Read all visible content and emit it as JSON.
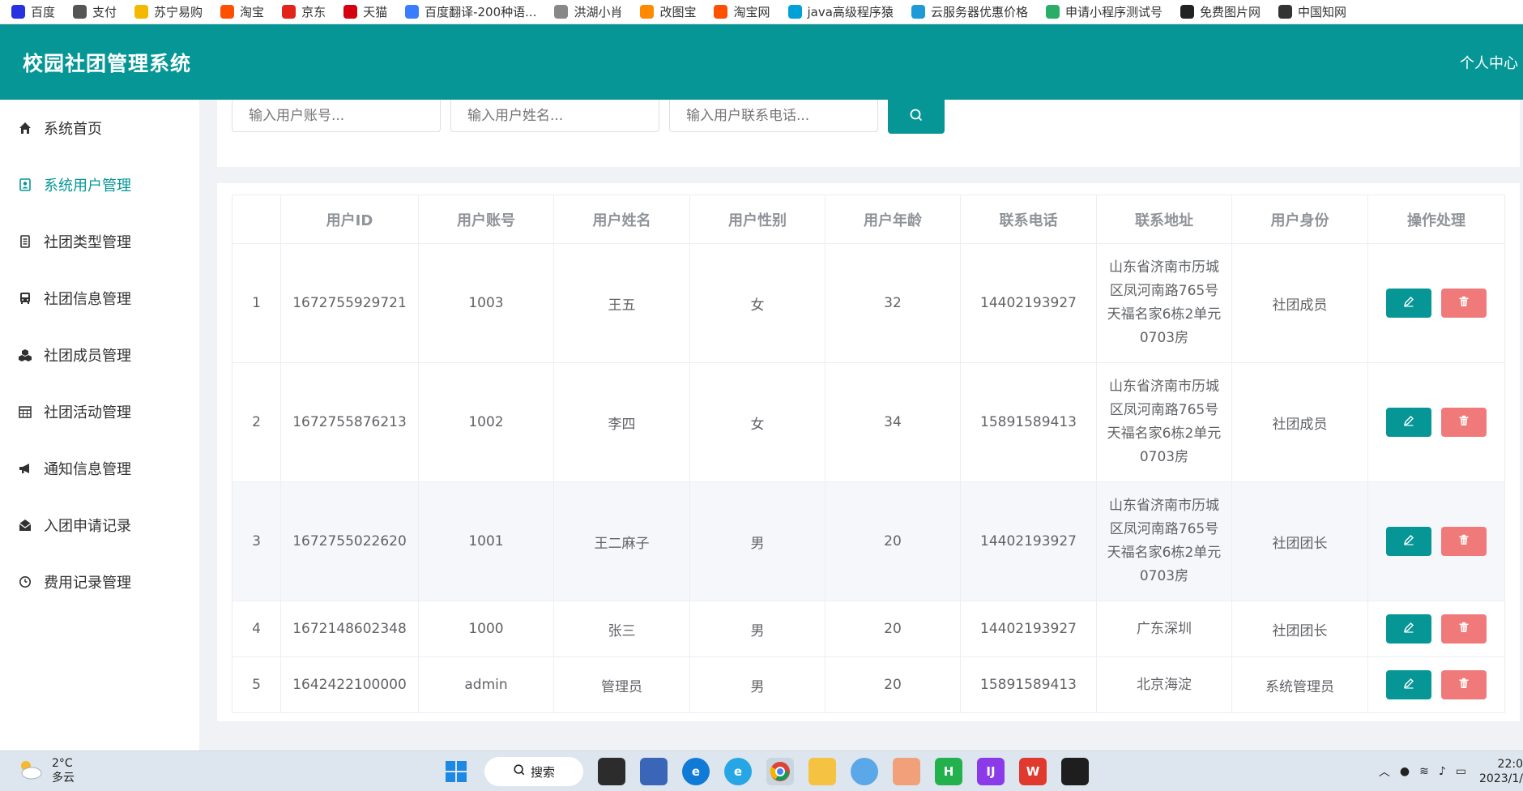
{
  "bookmarks": [
    {
      "label": "百度",
      "icon": "baidu-icon",
      "color": "#2932e1"
    },
    {
      "label": "支付",
      "icon": "globe-icon",
      "color": "#555555"
    },
    {
      "label": "苏宁易购",
      "icon": "suning-icon",
      "color": "#f5b800"
    },
    {
      "label": "淘宝",
      "icon": "taobao-icon",
      "color": "#ff5000"
    },
    {
      "label": "京东",
      "icon": "jd-icon",
      "color": "#e1251b"
    },
    {
      "label": "天猫",
      "icon": "tmall-icon",
      "color": "#d4000f"
    },
    {
      "label": "百度翻译-200种语...",
      "icon": "translate-icon",
      "color": "#3b7cff"
    },
    {
      "label": "洪湖小肖",
      "icon": "rocket-icon",
      "color": "#888888"
    },
    {
      "label": "改图宝",
      "icon": "image-edit-icon",
      "color": "#ff8a00"
    },
    {
      "label": "淘宝网",
      "icon": "taobao-icon",
      "color": "#ff5000"
    },
    {
      "label": "java高级程序猿",
      "icon": "tv-icon",
      "color": "#00a1d6"
    },
    {
      "label": "云服务器优惠价格",
      "icon": "cloud-icon",
      "color": "#1e9bd7"
    },
    {
      "label": "申请小程序测试号",
      "icon": "wechat-icon",
      "color": "#2aae67"
    },
    {
      "label": "免费图片网",
      "icon": "t-icon",
      "color": "#222222"
    },
    {
      "label": "中国知网",
      "icon": "cnki-icon",
      "color": "#333333"
    }
  ],
  "header": {
    "title": "校园社团管理系统",
    "user_center": "个人中心"
  },
  "sidebar": {
    "items": [
      {
        "label": "系统首页",
        "icon": "home-icon",
        "active": false
      },
      {
        "label": "系统用户管理",
        "icon": "user-card-icon",
        "active": true
      },
      {
        "label": "社团类型管理",
        "icon": "list-icon",
        "active": false
      },
      {
        "label": "社团信息管理",
        "icon": "bus-icon",
        "active": false
      },
      {
        "label": "社团成员管理",
        "icon": "cubes-icon",
        "active": false
      },
      {
        "label": "社团活动管理",
        "icon": "calendar-icon",
        "active": false
      },
      {
        "label": "通知信息管理",
        "icon": "bullhorn-icon",
        "active": false
      },
      {
        "label": "入团申请记录",
        "icon": "envelope-icon",
        "active": false
      },
      {
        "label": "费用记录管理",
        "icon": "clock-icon",
        "active": false
      }
    ]
  },
  "search": {
    "account_placeholder": "输入用户账号...",
    "name_placeholder": "输入用户姓名...",
    "phone_placeholder": "输入用户联系电话..."
  },
  "table": {
    "columns": [
      "",
      "用户ID",
      "用户账号",
      "用户姓名",
      "用户性别",
      "用户年龄",
      "联系电话",
      "联系地址",
      "用户身份",
      "操作处理"
    ],
    "rows": [
      {
        "index": "1",
        "id": "1672755929721",
        "account": "1003",
        "name": "王五",
        "gender": "女",
        "age": "32",
        "phone": "14402193927",
        "address": "山东省济南市历城区凤河南路765号天福名家6栋2单元0703房",
        "role": "社团成员"
      },
      {
        "index": "2",
        "id": "1672755876213",
        "account": "1002",
        "name": "李四",
        "gender": "女",
        "age": "34",
        "phone": "15891589413",
        "address": "山东省济南市历城区凤河南路765号天福名家6栋2单元0703房",
        "role": "社团成员"
      },
      {
        "index": "3",
        "id": "1672755022620",
        "account": "1001",
        "name": "王二麻子",
        "gender": "男",
        "age": "20",
        "phone": "14402193927",
        "address": "山东省济南市历城区凤河南路765号天福名家6栋2单元0703房",
        "role": "社团团长"
      },
      {
        "index": "4",
        "id": "1672148602348",
        "account": "1000",
        "name": "张三",
        "gender": "男",
        "age": "20",
        "phone": "14402193927",
        "address": "广东深圳",
        "role": "社团团长"
      },
      {
        "index": "5",
        "id": "1642422100000",
        "account": "admin",
        "name": "管理员",
        "gender": "男",
        "age": "20",
        "phone": "15891589413",
        "address": "北京海淀",
        "role": "系统管理员"
      }
    ]
  },
  "taskbar": {
    "weather_temp": "2°C",
    "weather_desc": "多云",
    "search_label": "搜索",
    "clock_time": "22:0",
    "clock_date": "2023/1/"
  },
  "colors": {
    "primary": "#069696",
    "danger": "#f07a7a"
  }
}
